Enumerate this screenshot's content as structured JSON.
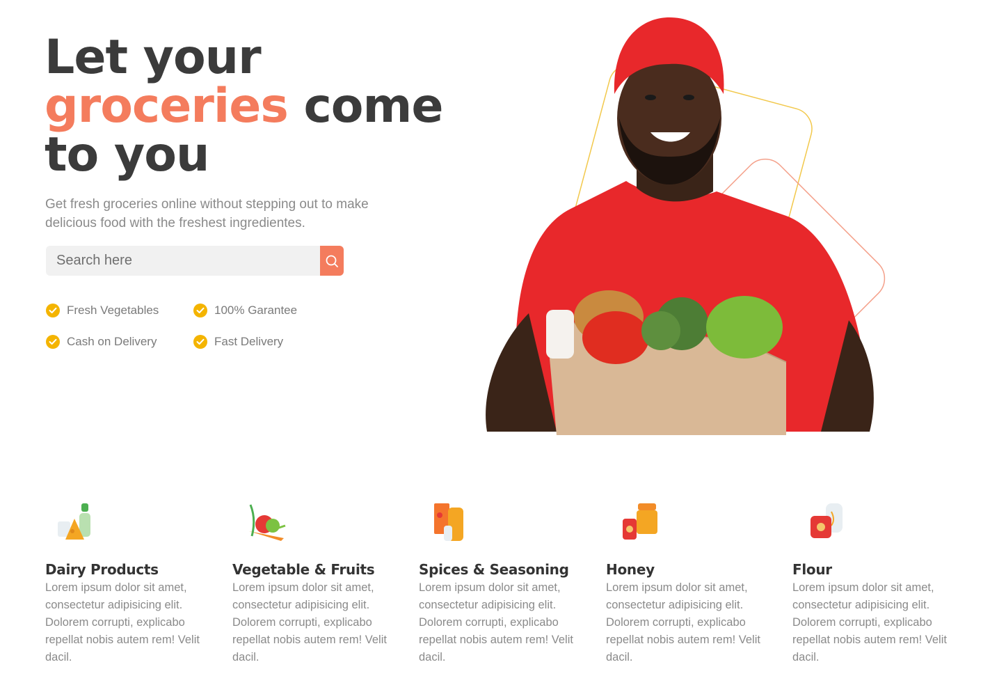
{
  "hero": {
    "title_line1": "Let your",
    "title_accent": "groceries",
    "title_line2_rest": " come",
    "title_line3": "to you",
    "subtitle": "Get fresh groceries online without stepping out to make delicious food with the freshest ingredientes.",
    "search_placeholder": "Search here",
    "features": [
      {
        "label": "Fresh Vegetables"
      },
      {
        "label": "100% Garantee"
      },
      {
        "label": "Cash on Delivery"
      },
      {
        "label": "Fast Delivery"
      }
    ]
  },
  "categories": [
    {
      "title": "Dairy Products",
      "text": "Lorem ipsum dolor sit amet, consectetur adipisicing elit. Dolorem corrupti, explicabo repellat nobis autem rem! Velit dacil.",
      "icon": "dairy-icon"
    },
    {
      "title": "Vegetable & Fruits",
      "text": "Lorem ipsum dolor sit amet, consectetur adipisicing elit. Dolorem corrupti, explicabo repellat nobis autem rem! Velit dacil.",
      "icon": "vegetables-icon"
    },
    {
      "title": "Spices & Seasoning",
      "text": "Lorem ipsum dolor sit amet, consectetur adipisicing elit. Dolorem corrupti, explicabo repellat nobis autem rem! Velit dacil.",
      "icon": "spices-icon"
    },
    {
      "title": "Honey",
      "text": "Lorem ipsum dolor sit amet, consectetur adipisicing elit. Dolorem corrupti, explicabo repellat nobis autem rem! Velit dacil.",
      "icon": "honey-icon"
    },
    {
      "title": "Flour",
      "text": "Lorem ipsum dolor sit amet, consectetur adipisicing elit. Dolorem corrupti, explicabo repellat nobis autem rem! Velit dacil.",
      "icon": "flour-icon"
    }
  ],
  "colors": {
    "accent": "#f47c5d",
    "check": "#f4b400",
    "heading": "#3b3b3b",
    "muted": "#8a8a8a"
  }
}
